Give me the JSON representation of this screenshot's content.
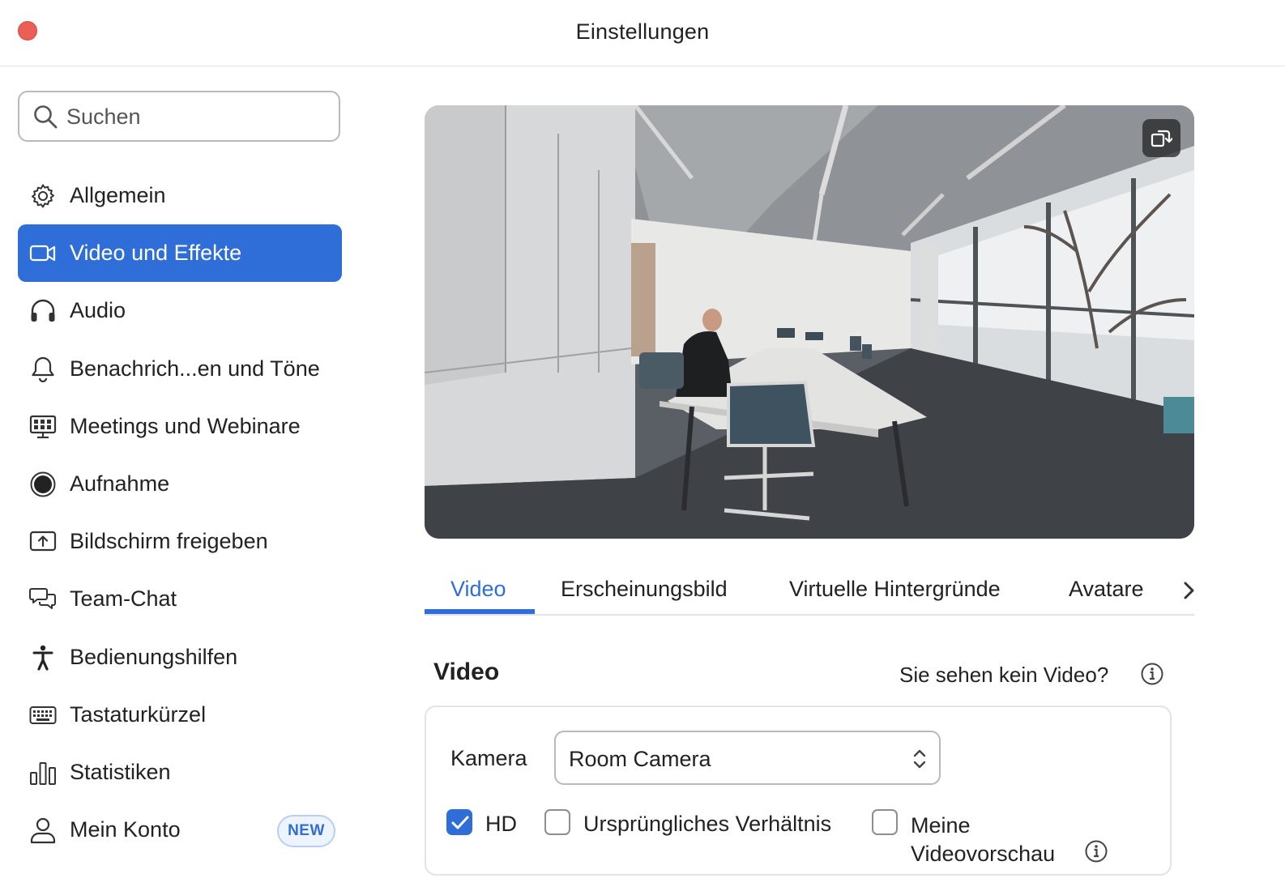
{
  "window": {
    "title": "Einstellungen"
  },
  "search": {
    "placeholder": "Suchen"
  },
  "sidebar": {
    "items": [
      {
        "label": "Allgemein",
        "icon": "gear-icon"
      },
      {
        "label": "Video und Effekte",
        "icon": "video-camera-icon",
        "active": true
      },
      {
        "label": "Audio",
        "icon": "headphones-icon"
      },
      {
        "label": "Benachrich...en und Töne",
        "icon": "bell-icon"
      },
      {
        "label": "Meetings und Webinare",
        "icon": "meeting-board-icon"
      },
      {
        "label": "Aufnahme",
        "icon": "record-icon"
      },
      {
        "label": "Bildschirm freigeben",
        "icon": "share-screen-icon"
      },
      {
        "label": "Team-Chat",
        "icon": "chat-bubbles-icon"
      },
      {
        "label": "Bedienungshilfen",
        "icon": "accessibility-icon"
      },
      {
        "label": "Tastaturkürzel",
        "icon": "keyboard-icon"
      },
      {
        "label": "Statistiken",
        "icon": "bar-chart-icon"
      },
      {
        "label": "Mein Konto",
        "icon": "user-icon",
        "badge": "NEW"
      }
    ]
  },
  "preview": {
    "icon": "rotate-camera-icon"
  },
  "tabs": [
    {
      "label": "Video",
      "active": true
    },
    {
      "label": "Erscheinungsbild"
    },
    {
      "label": "Virtuelle Hintergründe"
    },
    {
      "label": "Avatare"
    }
  ],
  "video_section": {
    "title": "Video",
    "help": "Sie sehen kein Video?",
    "camera_label": "Kamera",
    "camera_value": "Room Camera",
    "options": [
      {
        "label": "HD",
        "checked": true
      },
      {
        "label": "Ursprüngliches Verhältnis",
        "checked": false
      },
      {
        "label": "Meine Videovorschau",
        "checked": false
      }
    ]
  },
  "colors": {
    "accent": "#2f6ed8",
    "close": "#ec5f57"
  }
}
